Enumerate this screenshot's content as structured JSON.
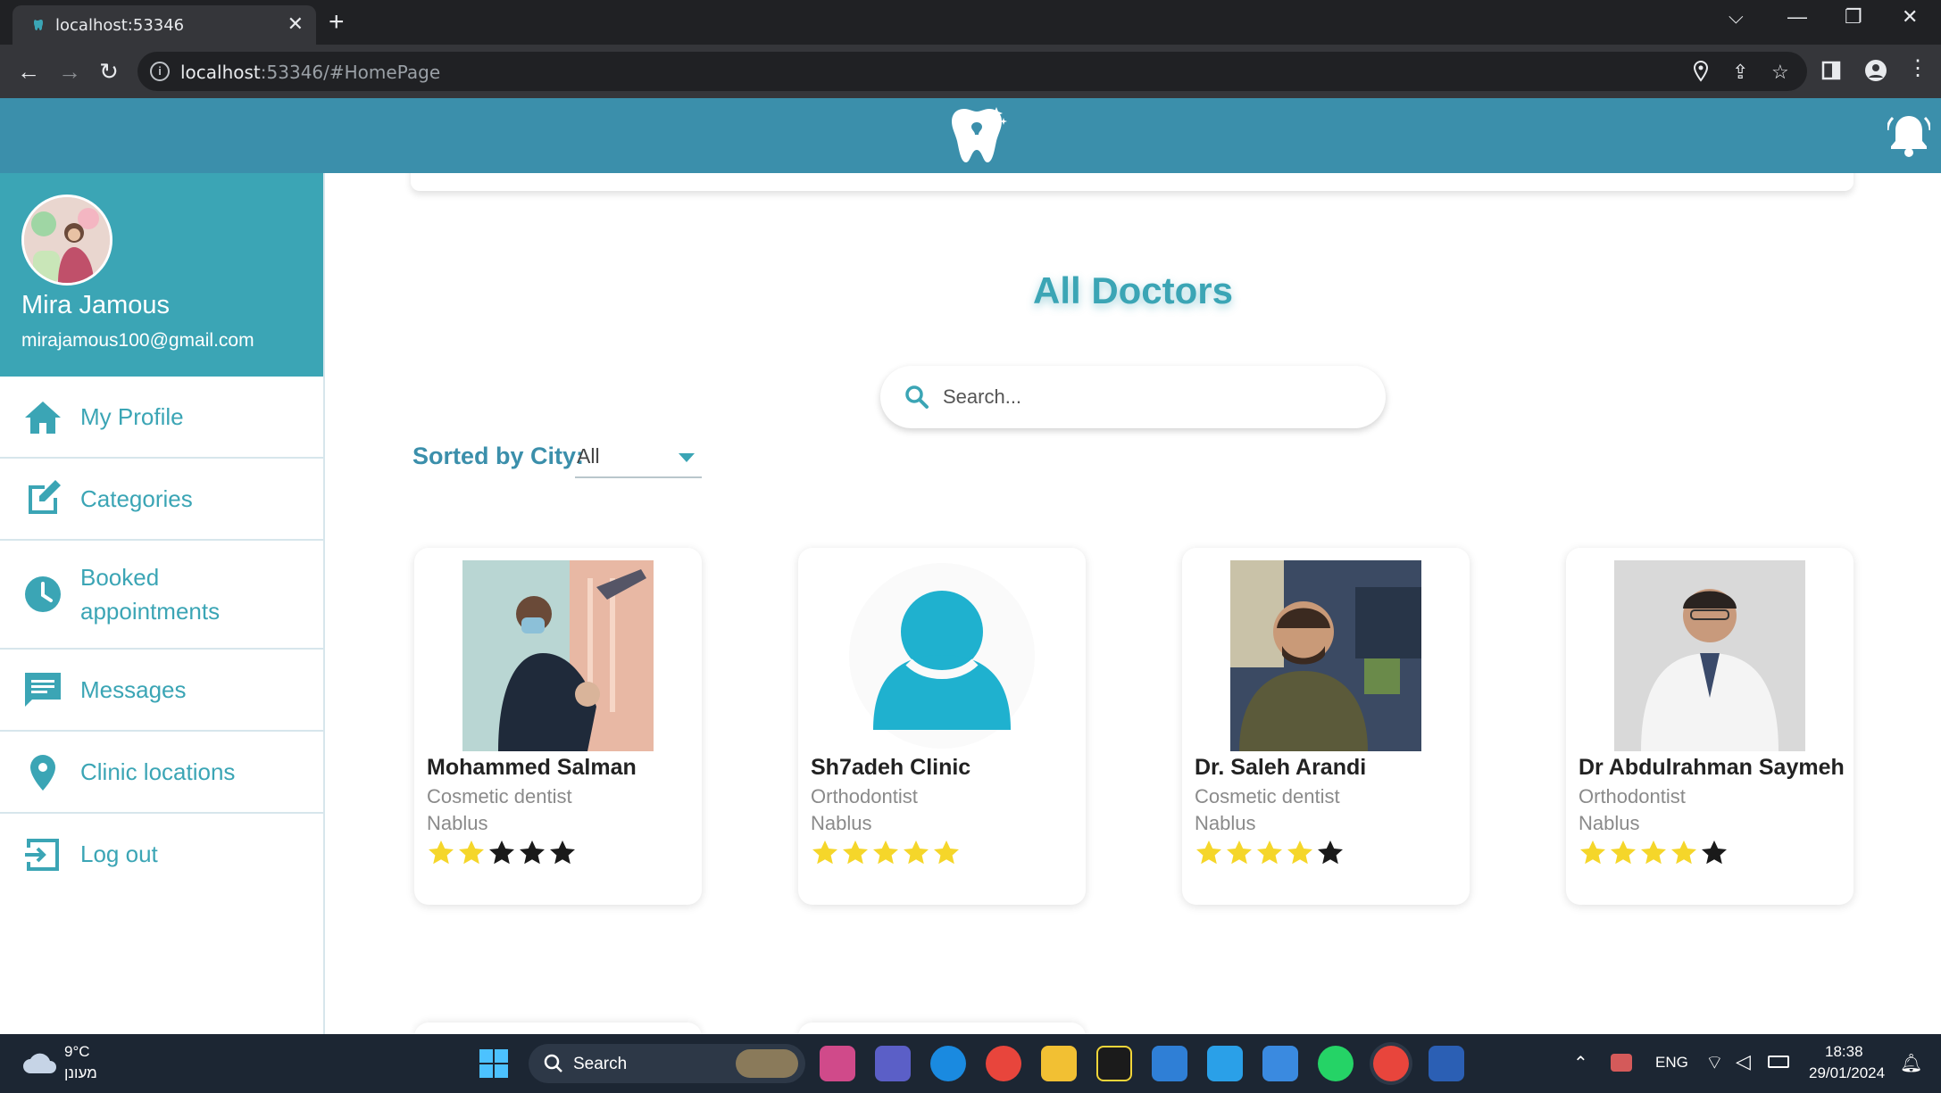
{
  "browser": {
    "tab_title": "localhost:53346",
    "url_host": "localhost",
    "url_path": ":53346/#HomePage"
  },
  "user": {
    "name": "Mira Jamous",
    "email": "mirajamous100@gmail.com"
  },
  "menu": [
    {
      "label": "My Profile",
      "icon": "home-icon"
    },
    {
      "label": "Categories",
      "icon": "edit-icon"
    },
    {
      "label": "Booked appointments",
      "icon": "clock-icon"
    },
    {
      "label": "Messages",
      "icon": "message-icon"
    },
    {
      "label": "Clinic locations",
      "icon": "location-pin-icon"
    },
    {
      "label": "Log out",
      "icon": "logout-icon"
    }
  ],
  "main": {
    "title": "All Doctors",
    "search_placeholder": "Search...",
    "sort_label": "Sorted by City:",
    "sort_value": "All"
  },
  "doctors": [
    {
      "name": "Mohammed Salman",
      "specialty": "Cosmetic dentist",
      "city": "Nablus",
      "rating": 2
    },
    {
      "name": "Sh7adeh Clinic",
      "specialty": "Orthodontist",
      "city": "Nablus",
      "rating": 5
    },
    {
      "name": "Dr. Saleh Arandi",
      "specialty": "Cosmetic dentist",
      "city": "Nablus",
      "rating": 4
    },
    {
      "name": "Dr Abdulrahman Saymeh",
      "specialty": "Orthodontist",
      "city": "Nablus",
      "rating": 4
    }
  ],
  "taskbar": {
    "temperature": "9°C",
    "weather": "מעונן",
    "search_label": "Search",
    "language": "ENG",
    "time": "18:38",
    "date": "29/01/2024"
  },
  "colors": {
    "header": "#3b8fab",
    "accent": "#3ba5b5",
    "star_filled": "#f5d62a",
    "star_empty": "#1a1a1a"
  }
}
